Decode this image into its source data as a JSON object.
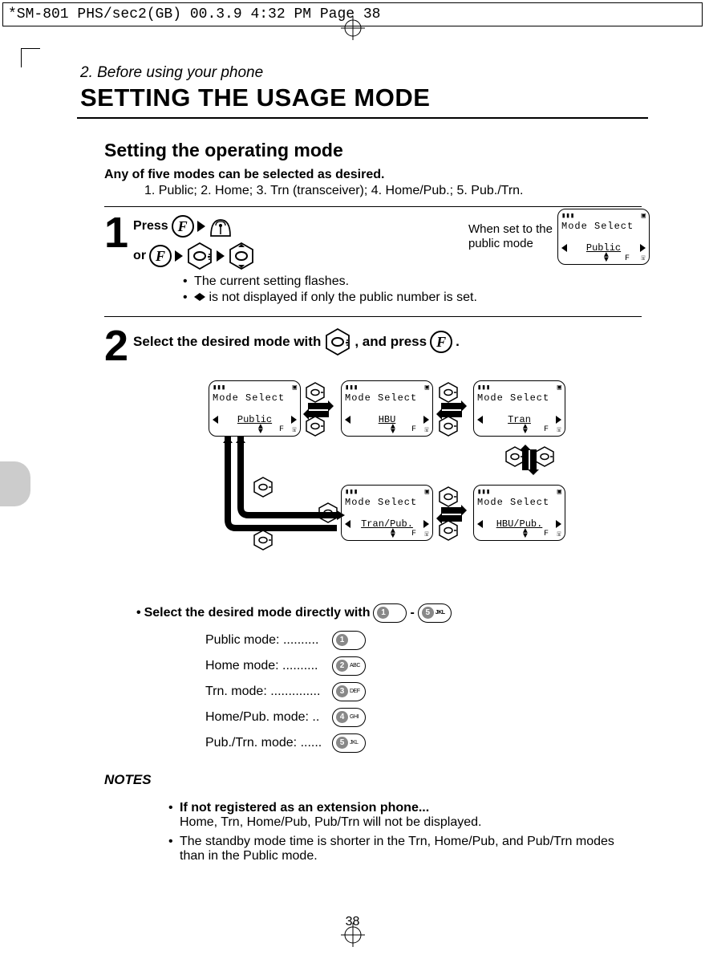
{
  "header_strip": "*SM-801 PHS/sec2(GB)  00.3.9 4:32 PM  Page 38",
  "chapter": "2. Before using your phone",
  "page_title": "SETTING THE USAGE MODE",
  "subhead": "Setting the operating mode",
  "intro_bold": "Any of five modes can be selected as desired.",
  "intro_list": "1. Public; 2. Home; 3. Trn (transceiver); 4. Home/Pub.; 5. Pub./Trn.",
  "step1": {
    "num": "1",
    "press_label": "Press",
    "or_label": "or",
    "bullet1": "The current setting flashes.",
    "bullet2_pre": "",
    "bullet2_post": " is not displayed if only the public number is set.",
    "side_text_l1": "When set to the",
    "side_text_l2": "public mode"
  },
  "step2": {
    "num": "2",
    "text_a": "Select the desired mode with ",
    "text_b": " , and press ",
    "text_c": " ."
  },
  "lcd": {
    "title": "Mode Select",
    "public": "Public",
    "hbu": "HBU",
    "tran": "Tran",
    "tranpub": "Tran/Pub.",
    "hbupub": "HBU/Pub.",
    "f": "F"
  },
  "direct": {
    "title_a": "Select the desired mode directly with ",
    "dash": " - ",
    "items": [
      {
        "label": "Public mode:  ..........",
        "key": "1",
        "chars": ""
      },
      {
        "label": "Home mode:  ..........",
        "key": "2",
        "chars": "ABC"
      },
      {
        "label": "Trn. mode:  ..............",
        "key": "3",
        "chars": "DEF"
      },
      {
        "label": "Home/Pub. mode:  ..",
        "key": "4",
        "chars": "GHI"
      },
      {
        "label": "Pub./Trn. mode: ......",
        "key": "5",
        "chars": "JKL"
      }
    ],
    "key_first": "1",
    "key_last": "5",
    "key_last_chars": "JKL"
  },
  "notes": {
    "heading": "NOTES",
    "n1_bold": "If not registered as an extension phone...",
    "n1_body": "Home, Trn, Home/Pub, Pub/Trn will not be displayed.",
    "n2": "The standby mode time is shorter in the Trn, Home/Pub, and Pub/Trn modes than in the Public mode."
  },
  "page_number": "38"
}
